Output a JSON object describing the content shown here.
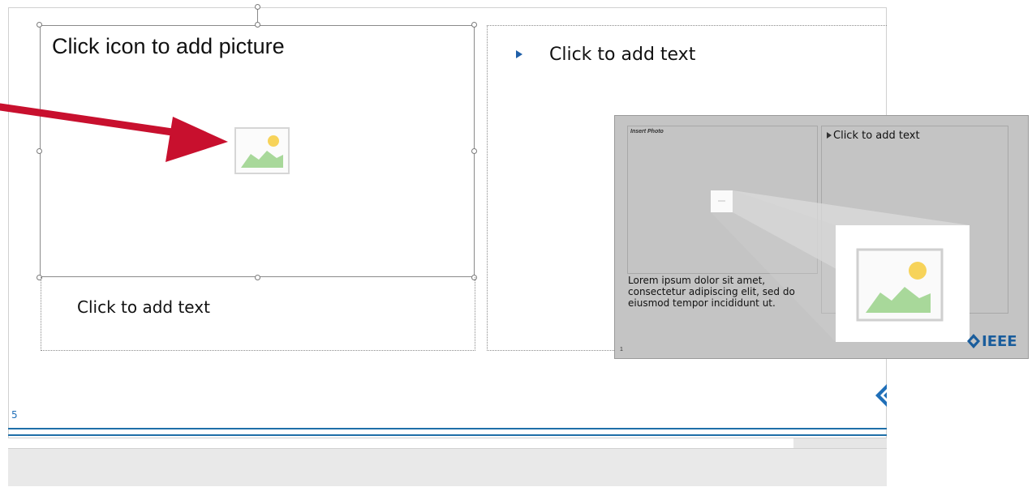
{
  "slide": {
    "picture_placeholder_title": "Click icon to add picture",
    "caption_placeholder_text": "Click to add text",
    "content_placeholder_text": "Click to add text",
    "slide_number": "5",
    "accent_color": "#1f6fa8"
  },
  "annotation": {
    "arrow_color": "#c8102e",
    "icon": "insert-picture-icon"
  },
  "thumbnail": {
    "insert_photo_label": "Insert Photo",
    "content_text": "Click to add text",
    "lorem_text": "Lorem ipsum dolor sit amet, consectetur adipiscing elit, sed do eiusmod tempor incididunt ut.",
    "slide_number": "1",
    "logo_text": "IEEE",
    "logo_color": "#1a5d9c"
  }
}
